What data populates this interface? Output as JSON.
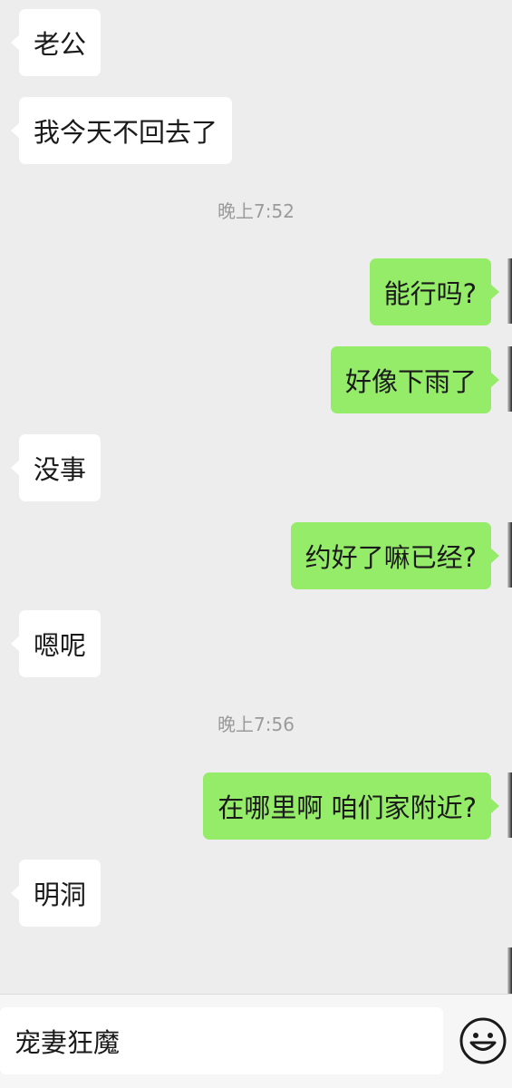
{
  "messages": [
    {
      "side": "left",
      "text": "老公"
    },
    {
      "side": "left",
      "text": "我今天不回去了"
    },
    {
      "type": "timestamp",
      "text": "晚上7:52"
    },
    {
      "side": "right",
      "text": "能行吗?"
    },
    {
      "side": "right",
      "text": "好像下雨了"
    },
    {
      "side": "left",
      "text": "没事"
    },
    {
      "side": "right",
      "text": "约好了嘛已经?"
    },
    {
      "side": "left",
      "text": "嗯呢"
    },
    {
      "type": "timestamp",
      "text": "晚上7:56"
    },
    {
      "side": "right",
      "text": "在哪里啊 咱们家附近?"
    },
    {
      "side": "left",
      "text": "明洞"
    }
  ],
  "input": {
    "value": "宠妻狂魔"
  },
  "icons": {
    "emoji_button": "smiley-face-icon"
  },
  "colors": {
    "background": "#ededed",
    "sent_bubble": "#95ec69",
    "received_bubble": "#ffffff",
    "timestamp_text": "#9b9b9b"
  }
}
